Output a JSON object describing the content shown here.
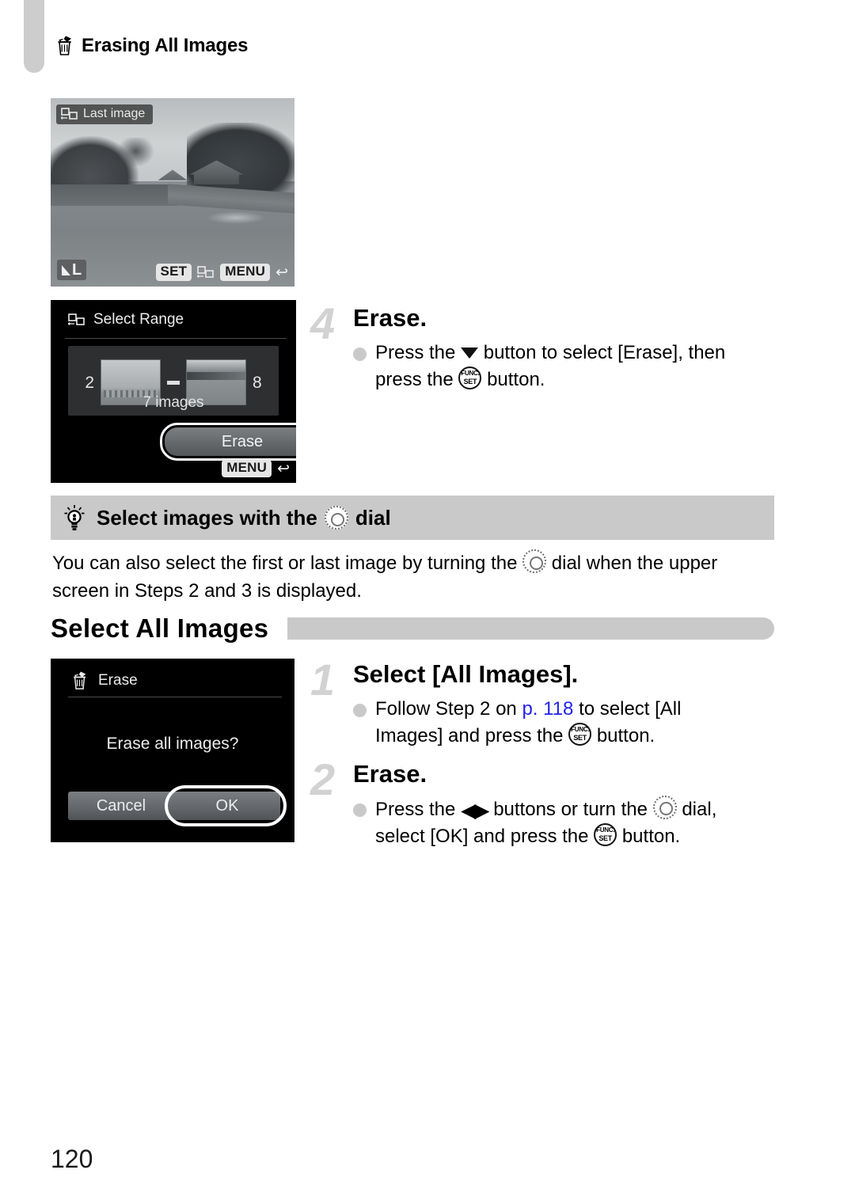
{
  "page": {
    "number": "120",
    "running_head": "Erasing All Images",
    "running_head_icon": "trash-erase-icon",
    "tab_marker_color": "#cdcdcd"
  },
  "screens": {
    "last_image": {
      "label": "Last image",
      "label_icon": "select-range-icon",
      "quality_badge": "L",
      "bottom_bar": {
        "set_button": "SET",
        "range_icon": "select-range-icon",
        "menu_button": "MENU",
        "return_icon": "return-arrow-icon"
      }
    },
    "select_range": {
      "title": "Select Range",
      "title_icon": "select-range-icon",
      "first_index": "2",
      "last_index": "8",
      "count_text": "7 images",
      "action_button": "Erase",
      "menu_button": "MENU",
      "return_icon": "return-arrow-icon"
    },
    "erase_all": {
      "title": "Erase",
      "title_icon": "trash-erase-icon",
      "question": "Erase all images?",
      "cancel_button": "Cancel",
      "ok_button": "OK"
    }
  },
  "steps": {
    "step4": {
      "number": "4",
      "title": "Erase.",
      "body_1": "Press the",
      "body_2": "button to select [Erase], then",
      "body_3": "press the",
      "body_4": "button."
    },
    "step1": {
      "number": "1",
      "title": "Select [All Images].",
      "body_1": "Follow Step 2 on",
      "link": "p. 118",
      "body_2": "to select [All",
      "body_3": "Images] and press the",
      "body_4": "button."
    },
    "step2": {
      "number": "2",
      "title": "Erase.",
      "body_1": "Press the",
      "body_2": "buttons or turn the",
      "body_3": "dial,",
      "body_4": "select [OK] and press the",
      "body_5": "button."
    }
  },
  "tip": {
    "icon": "lightbulb-icon",
    "title_1": "Select images with the",
    "title_2": "dial",
    "body_1": "You can also select the first or last image by turning the",
    "body_2": "dial when the upper",
    "body_3": "screen in Steps 2 and 3 is displayed."
  },
  "section": {
    "heading": "Select All Images",
    "bar_color": "#c9c9c9"
  },
  "icons": {
    "func_set_top": "FUNC.",
    "func_set_bottom": "SET",
    "arrow_down": "▼",
    "arrow_left_right": "◀▶",
    "return_arrow": "↰"
  },
  "colors": {
    "link": "#2222ee",
    "gray_bar": "#c9c9c9",
    "step_number": "#d2d2d2",
    "bullet": "#c9c9c9"
  }
}
